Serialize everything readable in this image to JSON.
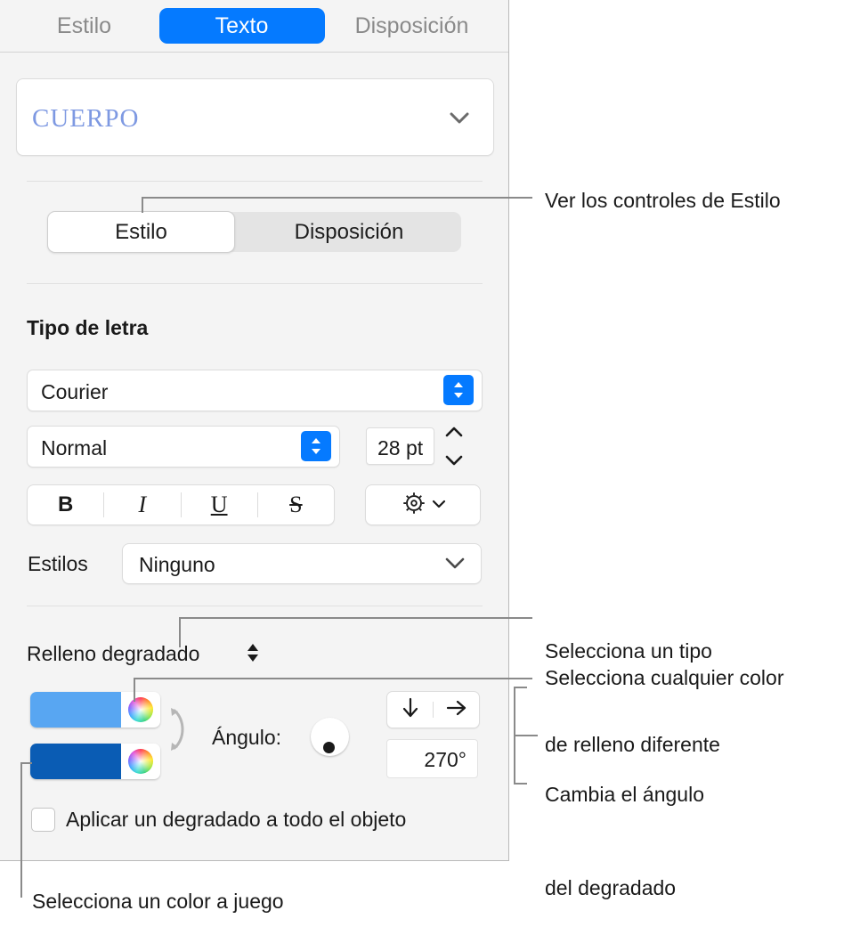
{
  "panel": {
    "top_tabs": [
      {
        "label": "Estilo",
        "active": false
      },
      {
        "label": "Texto",
        "active": true
      },
      {
        "label": "Disposición",
        "active": false
      }
    ],
    "paragraph_style": "CUERPO",
    "segmented": [
      {
        "label": "Estilo",
        "selected": true
      },
      {
        "label": "Disposición",
        "selected": false
      }
    ],
    "font_section_title": "Tipo de letra",
    "font_name": "Courier",
    "font_style": "Normal",
    "font_size": "28 pt",
    "format_buttons": [
      {
        "name": "bold",
        "label": "B"
      },
      {
        "name": "italic",
        "label": "I"
      },
      {
        "name": "underline",
        "label": "U"
      },
      {
        "name": "strikethrough",
        "label": "S"
      }
    ],
    "styles_label": "Estilos",
    "styles_value": "Ninguno",
    "fill_type": "Relleno degradado",
    "gradient": {
      "start_color": "#58a6f2",
      "end_color": "#0a5cb4",
      "angle_label": "Ángulo:",
      "angle_value": "270°",
      "direction_vertical_icon": "arrow-down-icon",
      "direction_horizontal_icon": "arrow-right-icon"
    },
    "apply_gradient_checkbox": {
      "label": "Aplicar un degradado a todo el objeto",
      "checked": false
    }
  },
  "callouts": {
    "style_controls": "Ver los controles de Estilo",
    "fill_type_line1": "Selecciona un tipo",
    "fill_type_line2": "de relleno diferente",
    "any_color": "Selecciona cualquier color",
    "angle_line1": "Cambia el ángulo",
    "angle_line2": "del degradado",
    "matching_color": "Selecciona un color a juego"
  },
  "colors": {
    "accent_blue": "#057aff",
    "panel_bg": "#f4f4f4",
    "text": "#1a1a1a",
    "muted_text": "#8a8a8a",
    "leader_line": "#8a8a8a",
    "paragraph_style_text": "#7e99e2"
  }
}
